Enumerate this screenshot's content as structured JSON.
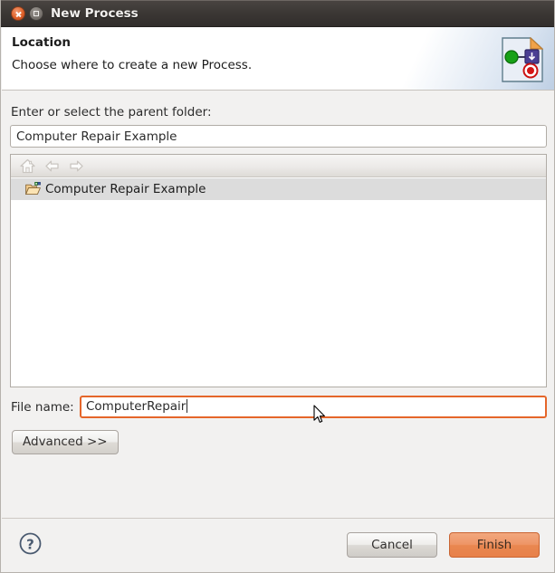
{
  "window": {
    "title": "New Process",
    "close_label": "Close",
    "maximize_label": "Maximize"
  },
  "header": {
    "title": "Location",
    "description": "Choose where to create a new Process.",
    "icon": "process-document-icon"
  },
  "parent_folder": {
    "label": "Enter or select the parent folder:",
    "value": "Computer Repair Example",
    "placeholder": ""
  },
  "tree": {
    "toolbar": [
      {
        "name": "home-icon",
        "label": "Home",
        "enabled": false
      },
      {
        "name": "back-arrow-icon",
        "label": "Back",
        "enabled": false
      },
      {
        "name": "forward-arrow-icon",
        "label": "Forward",
        "enabled": false
      }
    ],
    "rows": [
      {
        "label": "Computer Repair Example",
        "icon": "open-folder-icon",
        "selected": true
      }
    ]
  },
  "file_name": {
    "label": "File name:",
    "value": "ComputerRepair",
    "placeholder": ""
  },
  "advanced": {
    "label": "Advanced >>"
  },
  "footer": {
    "help_label": "?",
    "cancel_label": "Cancel",
    "finish_label": "Finish"
  },
  "colors": {
    "accent_orange": "#e5662a",
    "finish_button": "#ee9566",
    "titlebar": "#3b3734",
    "selection": "#dcdcdc"
  }
}
